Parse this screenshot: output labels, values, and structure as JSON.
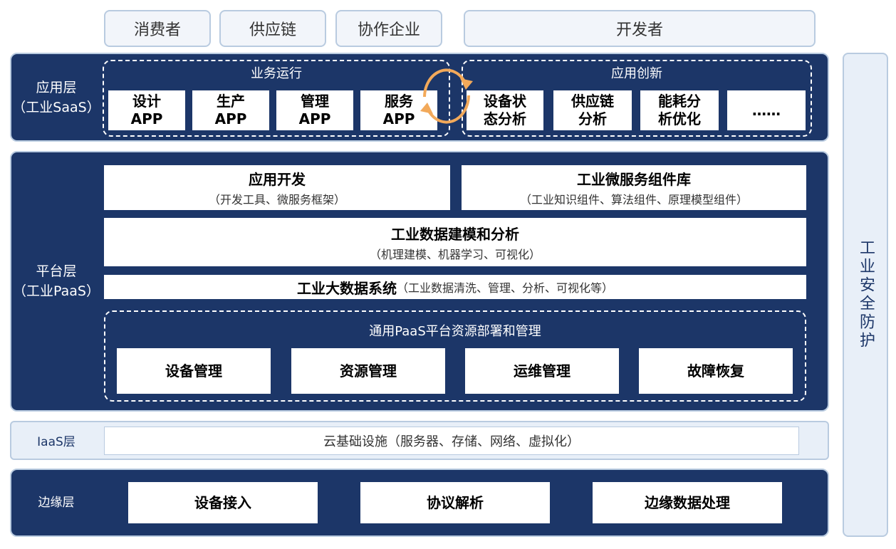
{
  "top": [
    "消费者",
    "供应链",
    "协作企业",
    "开发者"
  ],
  "saas": {
    "label_line1": "应用层",
    "label_line2": "（工业SaaS）",
    "left_group": {
      "title": "业务运行",
      "items": [
        {
          "l1": "设计",
          "l2": "APP"
        },
        {
          "l1": "生产",
          "l2": "APP"
        },
        {
          "l1": "管理",
          "l2": "APP"
        },
        {
          "l1": "服务",
          "l2": "APP"
        }
      ]
    },
    "right_group": {
      "title": "应用创新",
      "items": [
        {
          "l1": "设备状",
          "l2": "态分析"
        },
        {
          "l1": "供应链",
          "l2": "分析"
        },
        {
          "l1": "能耗分",
          "l2": "析优化"
        },
        {
          "l1": "……",
          "l2": ""
        }
      ]
    },
    "cycle_color": "#f2a95a"
  },
  "paas": {
    "label_line1": "平台层",
    "label_line2": "（工业PaaS）",
    "app_dev": {
      "title": "应用开发",
      "sub": "（开发工具、微服务框架）"
    },
    "micro": {
      "title": "工业微服务组件库",
      "sub": "（工业知识组件、算法组件、原理模型组件）"
    },
    "modeling": {
      "title": "工业数据建模和分析",
      "sub": "（机理建模、机器学习、可视化）"
    },
    "bigdata": {
      "title": "工业大数据系统",
      "sub": "（工业数据清洗、管理、分析、可视化等）"
    },
    "general": {
      "title": "通用PaaS平台资源部署和管理",
      "items": [
        "设备管理",
        "资源管理",
        "运维管理",
        "故障恢复"
      ]
    }
  },
  "iaas": {
    "label": "IaaS层",
    "content": "云基础设施（服务器、存储、网络、虚拟化）"
  },
  "edge": {
    "label": "边缘层",
    "items": [
      "设备接入",
      "协议解析",
      "边缘数据处理"
    ]
  },
  "security": "工业安全防护",
  "colors": {
    "navy": "#1c3668",
    "light": "#e8eff8",
    "border": "#b9cbe0"
  }
}
